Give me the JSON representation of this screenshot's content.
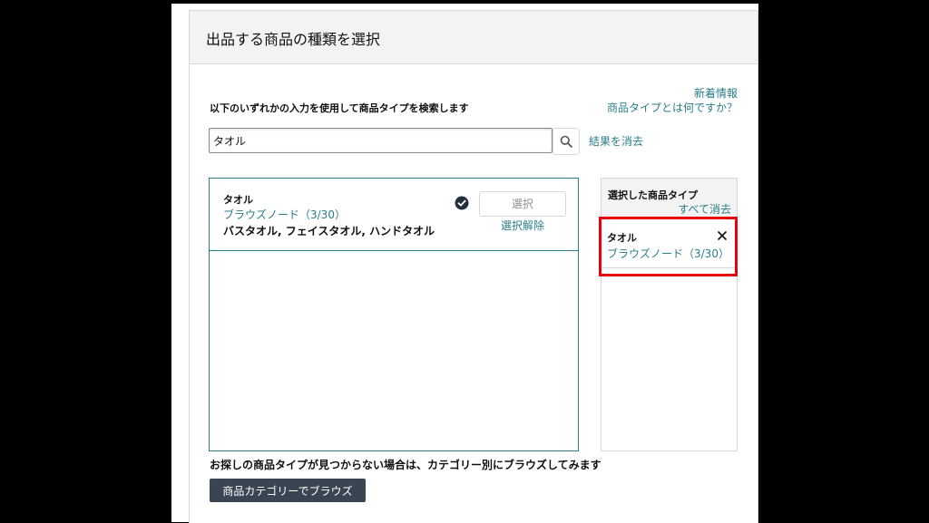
{
  "header": {
    "title": "出品する商品の種類を選択"
  },
  "links": {
    "whats_new": "新着情報",
    "what_is_product_type": "商品タイプとは何ですか？"
  },
  "search": {
    "instruction": "以下のいずれかの入力を使用して商品タイプを検索します",
    "value": "タオル",
    "clear_results": "結果を消去",
    "icon": "search-icon"
  },
  "results": [
    {
      "name": "タオル",
      "path": "ブラウズノード（3/30）",
      "description": "バスタオル, フェイスタオル, ハンドタオル",
      "select_label": "選択",
      "deselect_label": "選択解除",
      "selected": true
    }
  ],
  "selected_panel": {
    "title": "選択した商品タイプ",
    "clear_all": "すべて消去",
    "items": [
      {
        "name": "タオル",
        "path": "ブラウズノード（3/30）"
      }
    ]
  },
  "footer": {
    "hint": "お探しの商品タイプが見つからない場合は、カテゴリー別にブラウズしてみます",
    "browse_button": "商品カテゴリーでブラウズ"
  },
  "colors": {
    "link": "#2a7e89",
    "highlight": "#e8000c",
    "button_dark": "#3a4553"
  }
}
